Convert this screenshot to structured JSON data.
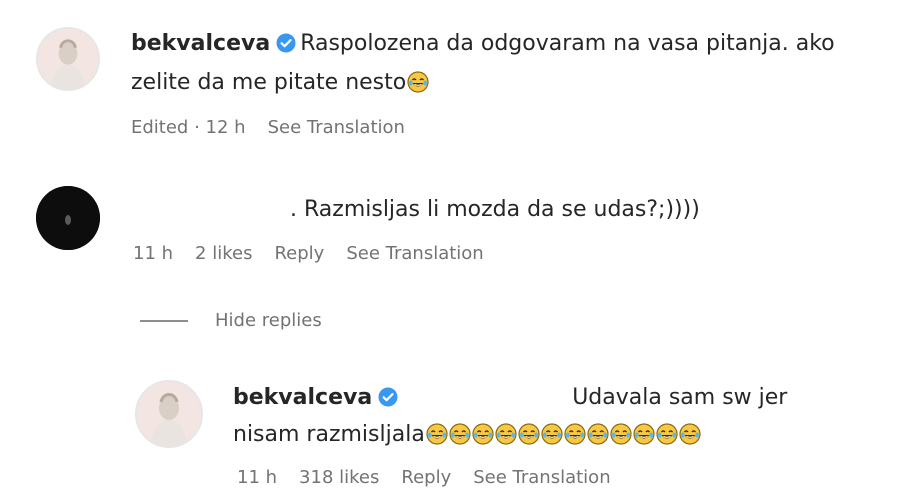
{
  "comments": {
    "main": {
      "username": "bekvalceva",
      "text_line1": "Raspolozena da odgovaram na vasa pitanja. ako",
      "text_line2": "zelite da me pitate nesto",
      "emoji": "face-with-tears-of-joy",
      "edited_time": "Edited · 12 h",
      "see_translation": "See Translation"
    },
    "second": {
      "text": ". Razmisljas li mozda da se udas?;))))",
      "time": "11 h",
      "likes": "2 likes",
      "reply": "Reply",
      "see_translation": "See Translation"
    },
    "hide_replies": "Hide replies",
    "reply": {
      "username": "bekvalceva",
      "text_line1": "Udavala sam sw jer",
      "text_line2": "nisam razmisljala",
      "emoji": "face-with-tears-of-joy",
      "emoji_count": 12,
      "time": "11 h",
      "likes": "318 likes",
      "reply": "Reply",
      "see_translation": "See Translation"
    }
  },
  "colors": {
    "text": "#262626",
    "secondary": "#737373",
    "verified": "#3897f0",
    "emoji_face": "#f7c844"
  }
}
